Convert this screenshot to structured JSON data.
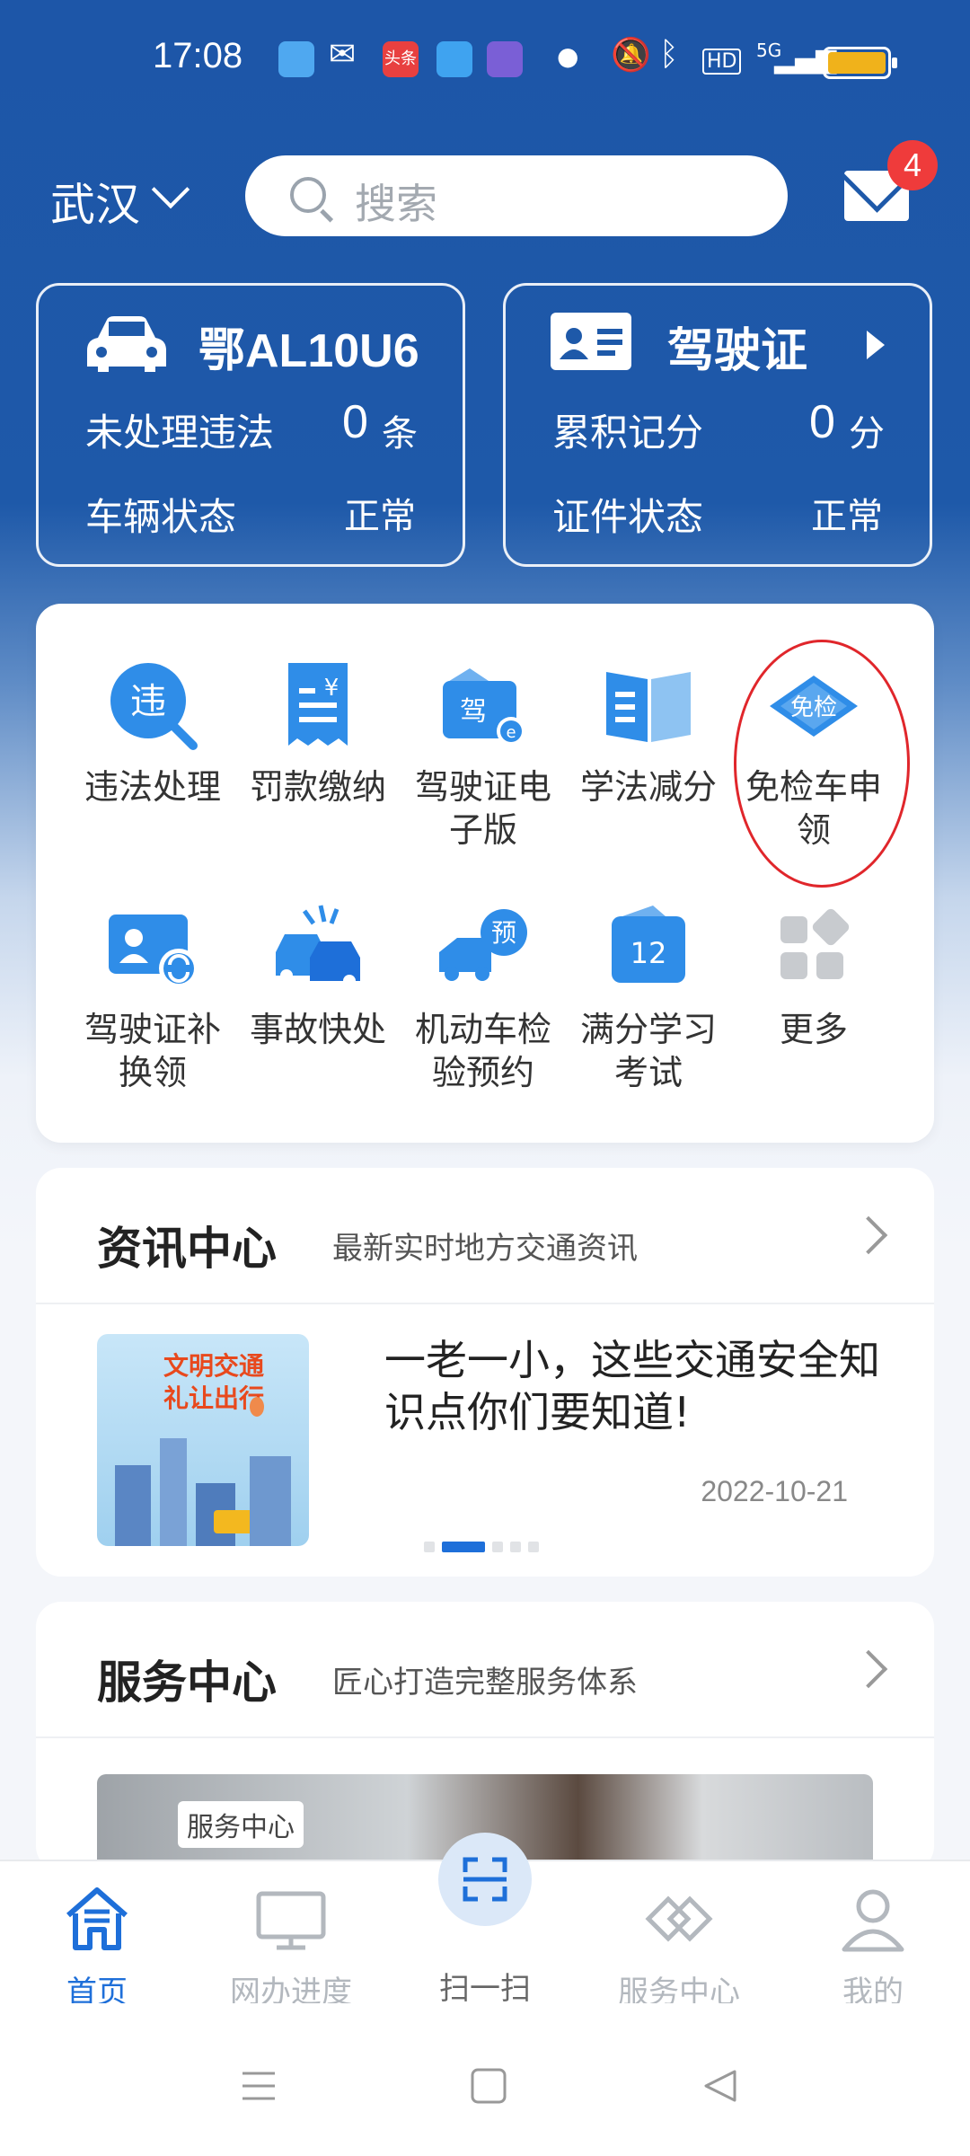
{
  "status_bar": {
    "time": "17:08",
    "network": "5G",
    "hd": "HD",
    "toutiao": "头条"
  },
  "header": {
    "city": "武汉",
    "search_placeholder": "搜索",
    "mail_badge": "4"
  },
  "vehicle_card": {
    "plate": "鄂AL10U6",
    "violations_label": "未处理违法",
    "violations_count": "0",
    "violations_unit": "条",
    "status_label": "车辆状态",
    "status_value": "正常"
  },
  "license_card": {
    "title": "驾驶证",
    "points_label": "累积记分",
    "points_value": "0",
    "points_unit": "分",
    "status_label": "证件状态",
    "status_value": "正常"
  },
  "services": [
    {
      "label": "违法处理",
      "icon": "violation-icon",
      "badge": "违"
    },
    {
      "label": "罚款缴纳",
      "icon": "fine-receipt-icon",
      "badge": "¥"
    },
    {
      "label": "驾驶证电子版",
      "icon": "e-license-icon",
      "badge": "驾"
    },
    {
      "label": "学法减分",
      "icon": "book-icon",
      "badge": ""
    },
    {
      "label": "免检车申领",
      "icon": "exempt-inspection-icon",
      "badge": "免检"
    },
    {
      "label": "驾驶证补换领",
      "icon": "license-renew-icon",
      "badge": ""
    },
    {
      "label": "事故快处",
      "icon": "accident-icon",
      "badge": ""
    },
    {
      "label": "机动车检验预约",
      "icon": "inspection-booking-icon",
      "badge": "预"
    },
    {
      "label": "满分学习考试",
      "icon": "calendar-icon",
      "badge": "12"
    },
    {
      "label": "更多",
      "icon": "more-grid-icon",
      "badge": ""
    }
  ],
  "news": {
    "title": "资讯中心",
    "subtitle": "最新实时地方交通资讯",
    "headline": "一老一小，这些交通安全知识点你们要知道!",
    "date": "2022-10-21",
    "thumb_text_line1": "文明交通",
    "thumb_text_line2": "礼让出行",
    "dot_count": 5,
    "active_dot": 1
  },
  "service_center": {
    "title": "服务中心",
    "subtitle": "匠心打造完整服务体系",
    "photo_tag": "服务中心"
  },
  "bottom_nav": [
    {
      "label": "首页",
      "icon": "home-icon",
      "active": true
    },
    {
      "label": "网办进度",
      "icon": "monitor-icon",
      "active": false
    },
    {
      "label": "扫一扫",
      "icon": "scan-icon",
      "active": false
    },
    {
      "label": "服务中心",
      "icon": "handshake-icon",
      "active": false
    },
    {
      "label": "我的",
      "icon": "user-icon",
      "active": false
    }
  ],
  "colors": {
    "brand_blue": "#1e59a9",
    "accent_blue": "#1e6fd9",
    "badge_red": "#ef3b3b"
  }
}
